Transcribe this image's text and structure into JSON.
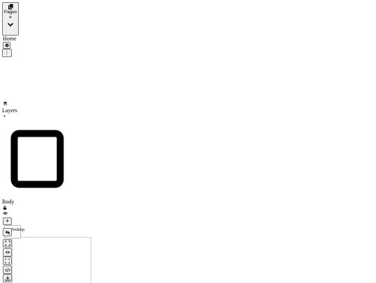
{
  "pages_panel": {
    "title": "Pages",
    "add_symbol": "+",
    "icon": "pages-icon",
    "collapse_icon": "chevron-down-icon"
  },
  "page_list": {
    "items": [
      {
        "label": "Home",
        "settings_icon": "gear-icon",
        "more_icon": "more-vertical-icon",
        "more_symbol": "⋮"
      }
    ]
  },
  "layers_panel": {
    "title": "Layers",
    "icon": "layers-icon",
    "arrow_icon": "caret-icon",
    "frame_icon": "square-frame-icon",
    "root_layer": {
      "label": "Body",
      "lock_icon": "lock-icon",
      "visibility_icon": "eye-icon"
    },
    "add_symbol": "+"
  },
  "device_toolbar": {
    "tooltip": "Desktop",
    "tools": [
      {
        "name": "hide-icon"
      },
      {
        "name": "fullscreen-icon"
      },
      {
        "name": "preview-icon"
      },
      {
        "name": "outline-icon"
      },
      {
        "name": "code-icon"
      },
      {
        "name": "download-icon"
      }
    ]
  }
}
